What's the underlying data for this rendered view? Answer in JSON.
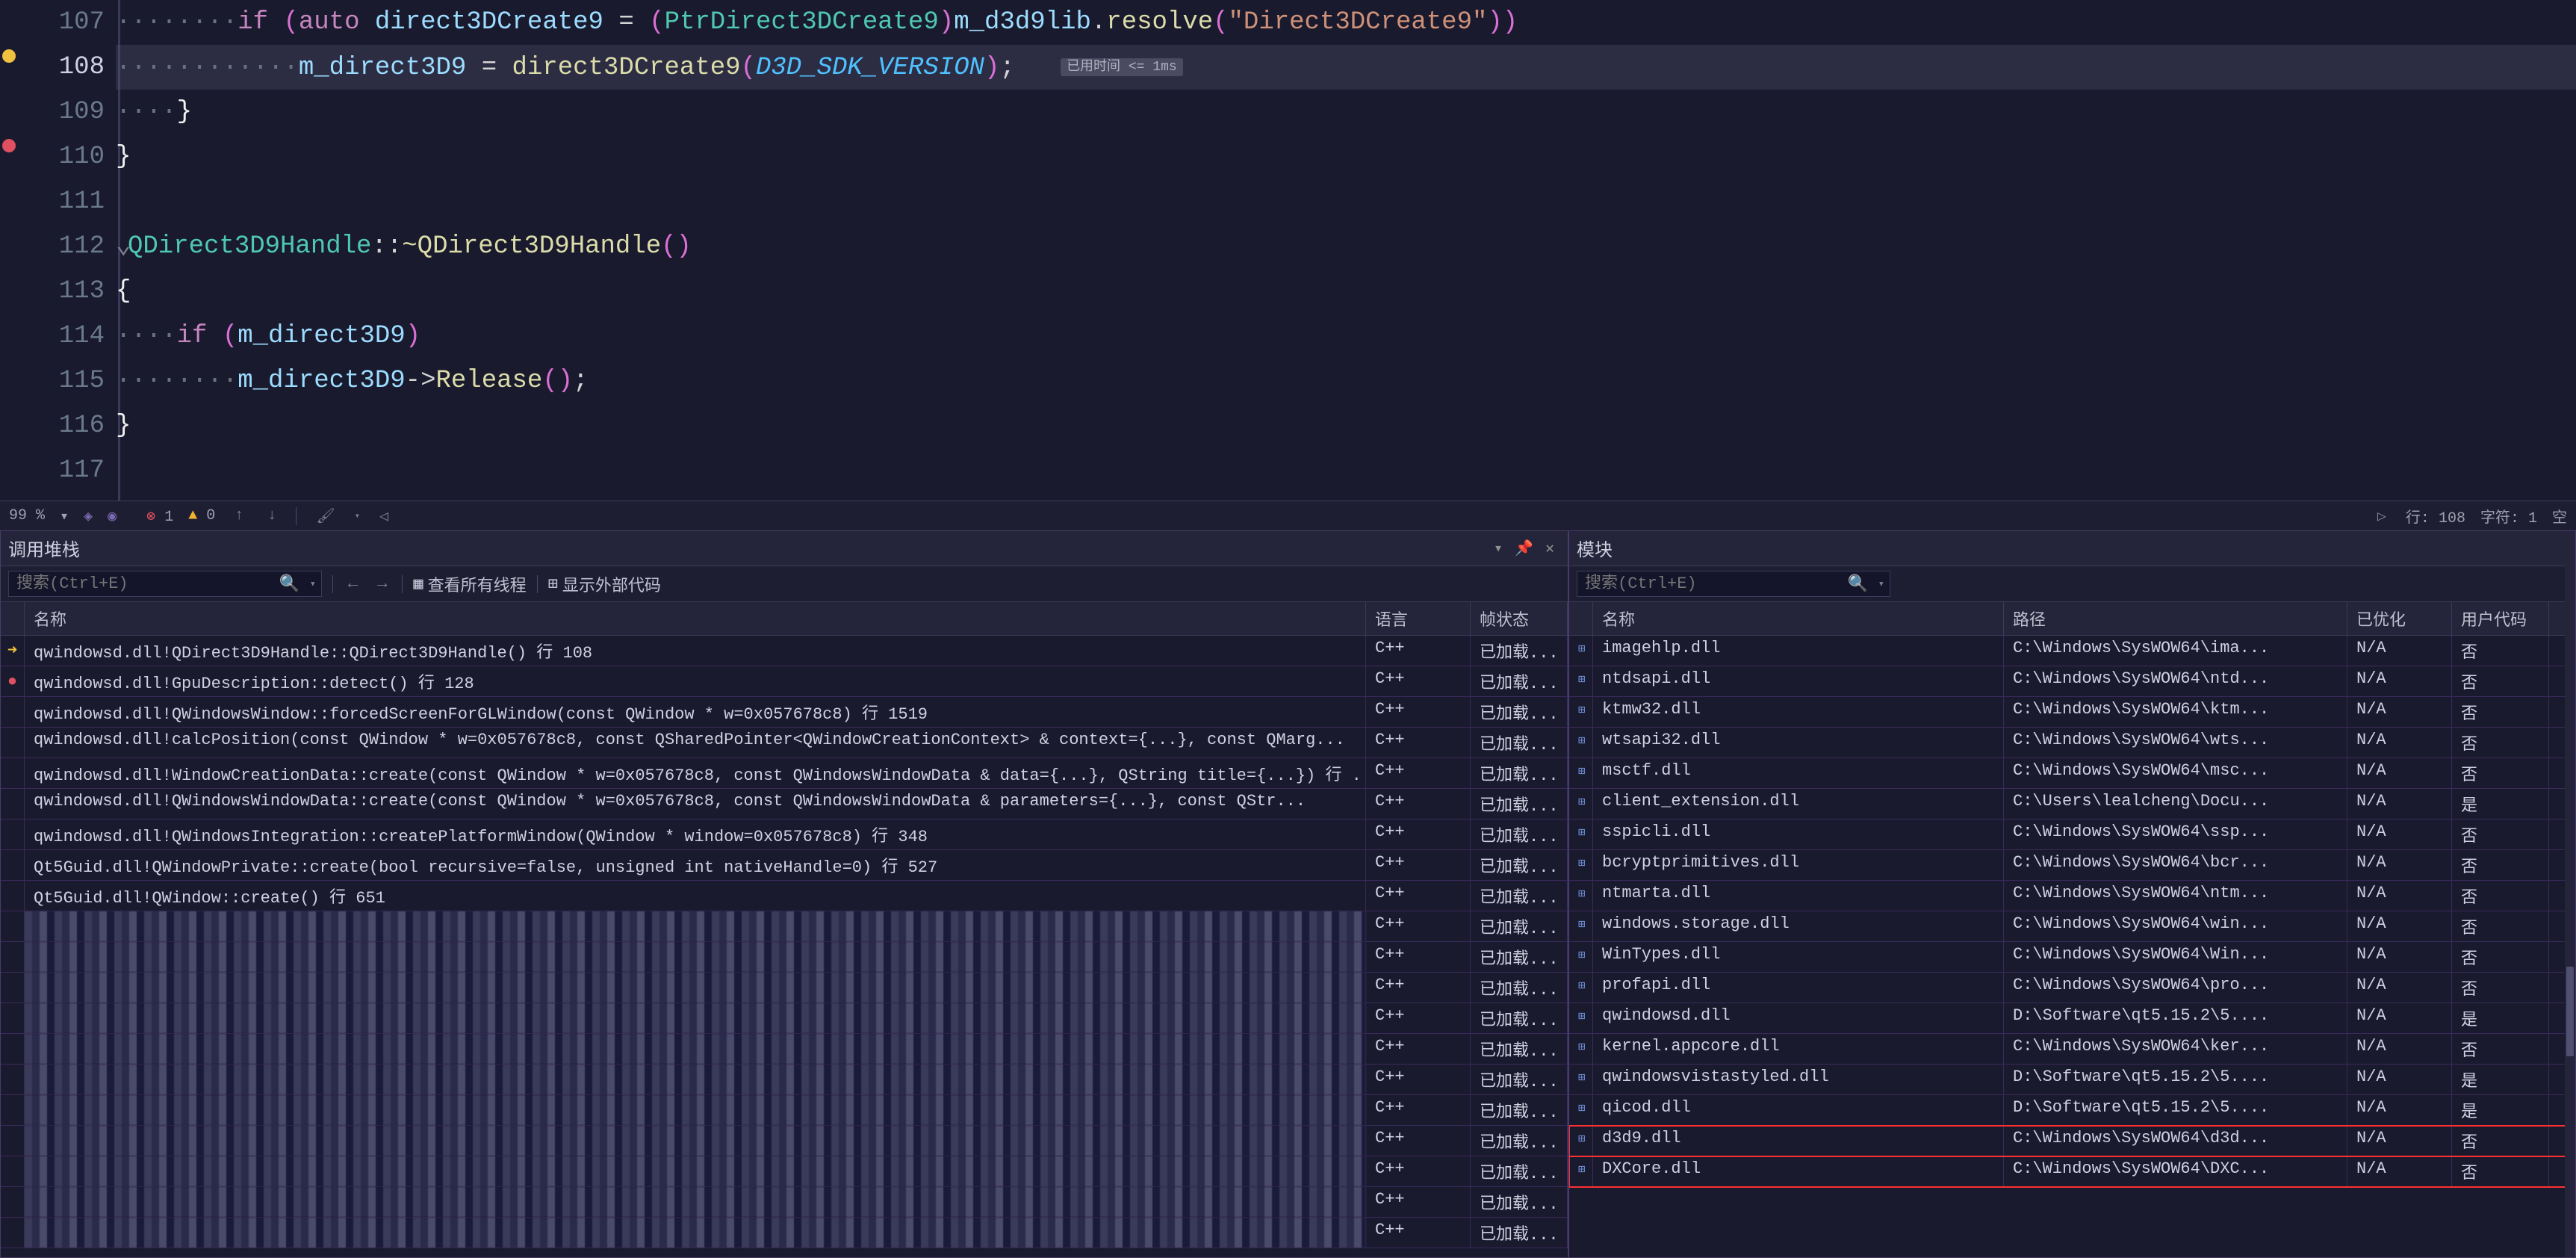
{
  "editor": {
    "lines": [
      {
        "num": "107",
        "bp": null
      },
      {
        "num": "108",
        "bp": "yellow",
        "current": true
      },
      {
        "num": "109",
        "bp": null
      },
      {
        "num": "110",
        "bp": "red"
      },
      {
        "num": "111",
        "bp": null
      },
      {
        "num": "112",
        "bp": null
      },
      {
        "num": "113",
        "bp": null
      },
      {
        "num": "114",
        "bp": null
      },
      {
        "num": "115",
        "bp": null
      },
      {
        "num": "116",
        "bp": null
      },
      {
        "num": "117",
        "bp": null
      }
    ],
    "hint": "已用时间 <= 1ms",
    "t107_if": "if",
    "t107_auto": "auto",
    "t107_var": "direct3DCreate9",
    "t107_member": "m_d3d9lib",
    "t107_resolve": "resolve",
    "t107_str": "\"Direct3DCreate9\"",
    "t107_cast": "PtrDirect3DCreate9",
    "t108_lhs": "m_direct3D9",
    "t108_call": "direct3DCreate9",
    "t108_arg": "D3D_SDK_VERSION",
    "t112_class": "QDirect3D9Handle",
    "t112_dtor": "~QDirect3D9Handle",
    "t114_if": "if",
    "t114_var": "m_direct3D9",
    "t115_var": "m_direct3D9",
    "t115_call": "Release"
  },
  "status": {
    "zoom": "99 %",
    "errors": "1",
    "warnings": "0",
    "line_label": "行:",
    "line_val": "108",
    "col_label": "字符:",
    "col_val": "1",
    "spaces": "空"
  },
  "callstack": {
    "title": "调用堆栈",
    "search_placeholder": "搜索(Ctrl+E)",
    "view_threads": "查看所有线程",
    "show_external": "显示外部代码",
    "col_name": "名称",
    "col_lang": "语言",
    "col_state": "帧状态",
    "rows": [
      {
        "icon": "arrow",
        "name": "qwindowsd.dll!QDirect3D9Handle::QDirect3D9Handle() 行 108",
        "lang": "C++",
        "state": "已加载..."
      },
      {
        "icon": "dot",
        "name": "qwindowsd.dll!GpuDescription::detect() 行 128",
        "lang": "C++",
        "state": "已加载..."
      },
      {
        "icon": "",
        "name": "qwindowsd.dll!QWindowsWindow::forcedScreenForGLWindow(const QWindow * w=0x057678c8) 行 1519",
        "lang": "C++",
        "state": "已加载..."
      },
      {
        "icon": "",
        "name": "qwindowsd.dll!calcPosition(const QWindow * w=0x057678c8, const QSharedPointer<QWindowCreationContext> & context={...}, const QMarg...",
        "lang": "C++",
        "state": "已加载..."
      },
      {
        "icon": "",
        "name": "qwindowsd.dll!WindowCreationData::create(const QWindow * w=0x057678c8, const QWindowsWindowData & data={...}, QString title={...}) 行 ...",
        "lang": "C++",
        "state": "已加载..."
      },
      {
        "icon": "",
        "name": "qwindowsd.dll!QWindowsWindowData::create(const QWindow * w=0x057678c8, const QWindowsWindowData & parameters={...}, const QStr...",
        "lang": "C++",
        "state": "已加载..."
      },
      {
        "icon": "",
        "name": "qwindowsd.dll!QWindowsIntegration::createPlatformWindow(QWindow * window=0x057678c8) 行 348",
        "lang": "C++",
        "state": "已加载..."
      },
      {
        "icon": "",
        "name": "Qt5Guid.dll!QWindowPrivate::create(bool recursive=false, unsigned int nativeHandle=0) 行 527",
        "lang": "C++",
        "state": "已加载..."
      },
      {
        "icon": "",
        "name": "Qt5Guid.dll!QWindow::create() 行 651",
        "lang": "C++",
        "state": "已加载..."
      },
      {
        "icon": "",
        "name": "",
        "lang": "C++",
        "state": "已加载...",
        "pixelated": true
      },
      {
        "icon": "",
        "name": "",
        "lang": "C++",
        "state": "已加载...",
        "pixelated": true
      },
      {
        "icon": "",
        "name": "",
        "lang": "C++",
        "state": "已加载...",
        "pixelated": true
      },
      {
        "icon": "",
        "name": "",
        "lang": "C++",
        "state": "已加载...",
        "pixelated": true
      },
      {
        "icon": "",
        "name": "",
        "lang": "C++",
        "state": "已加载...",
        "pixelated": true
      },
      {
        "icon": "",
        "name": "",
        "lang": "C++",
        "state": "已加载...",
        "pixelated": true
      },
      {
        "icon": "",
        "name": "",
        "lang": "C++",
        "state": "已加载...",
        "pixelated": true
      },
      {
        "icon": "",
        "name": "",
        "lang": "C++",
        "state": "已加载...",
        "pixelated": true
      },
      {
        "icon": "",
        "name": "",
        "lang": "C++",
        "state": "已加载...",
        "pixelated": true
      },
      {
        "icon": "",
        "name": "",
        "lang": "C++",
        "state": "已加载...",
        "pixelated": true
      },
      {
        "icon": "",
        "name": "",
        "lang": "C++",
        "state": "已加载...",
        "pixelated": true
      }
    ]
  },
  "modules": {
    "title": "模块",
    "search_placeholder": "搜索(Ctrl+E)",
    "col_name": "名称",
    "col_path": "路径",
    "col_opt": "已优化",
    "col_user": "用户代码",
    "rows": [
      {
        "name": "imagehlp.dll",
        "path": "C:\\Windows\\SysWOW64\\ima...",
        "opt": "N/A",
        "user": "否"
      },
      {
        "name": "ntdsapi.dll",
        "path": "C:\\Windows\\SysWOW64\\ntd...",
        "opt": "N/A",
        "user": "否"
      },
      {
        "name": "ktmw32.dll",
        "path": "C:\\Windows\\SysWOW64\\ktm...",
        "opt": "N/A",
        "user": "否"
      },
      {
        "name": "wtsapi32.dll",
        "path": "C:\\Windows\\SysWOW64\\wts...",
        "opt": "N/A",
        "user": "否"
      },
      {
        "name": "msctf.dll",
        "path": "C:\\Windows\\SysWOW64\\msc...",
        "opt": "N/A",
        "user": "否"
      },
      {
        "name": "client_extension.dll",
        "path": "C:\\Users\\lealcheng\\Docu...",
        "opt": "N/A",
        "user": "是"
      },
      {
        "name": "sspicli.dll",
        "path": "C:\\Windows\\SysWOW64\\ssp...",
        "opt": "N/A",
        "user": "否"
      },
      {
        "name": "bcryptprimitives.dll",
        "path": "C:\\Windows\\SysWOW64\\bcr...",
        "opt": "N/A",
        "user": "否"
      },
      {
        "name": "ntmarta.dll",
        "path": "C:\\Windows\\SysWOW64\\ntm...",
        "opt": "N/A",
        "user": "否"
      },
      {
        "name": "windows.storage.dll",
        "path": "C:\\Windows\\SysWOW64\\win...",
        "opt": "N/A",
        "user": "否"
      },
      {
        "name": "WinTypes.dll",
        "path": "C:\\Windows\\SysWOW64\\Win...",
        "opt": "N/A",
        "user": "否"
      },
      {
        "name": "profapi.dll",
        "path": "C:\\Windows\\SysWOW64\\pro...",
        "opt": "N/A",
        "user": "否"
      },
      {
        "name": "qwindowsd.dll",
        "path": "D:\\Software\\qt5.15.2\\5....",
        "opt": "N/A",
        "user": "是"
      },
      {
        "name": "kernel.appcore.dll",
        "path": "C:\\Windows\\SysWOW64\\ker...",
        "opt": "N/A",
        "user": "否"
      },
      {
        "name": "qwindowsvistastyled.dll",
        "path": "D:\\Software\\qt5.15.2\\5....",
        "opt": "N/A",
        "user": "是"
      },
      {
        "name": "qicod.dll",
        "path": "D:\\Software\\qt5.15.2\\5....",
        "opt": "N/A",
        "user": "是"
      },
      {
        "name": "d3d9.dll",
        "path": "C:\\Windows\\SysWOW64\\d3d...",
        "opt": "N/A",
        "user": "否",
        "hl": true
      },
      {
        "name": "DXCore.dll",
        "path": "C:\\Windows\\SysWOW64\\DXC...",
        "opt": "N/A",
        "user": "否",
        "hl": true
      }
    ]
  }
}
